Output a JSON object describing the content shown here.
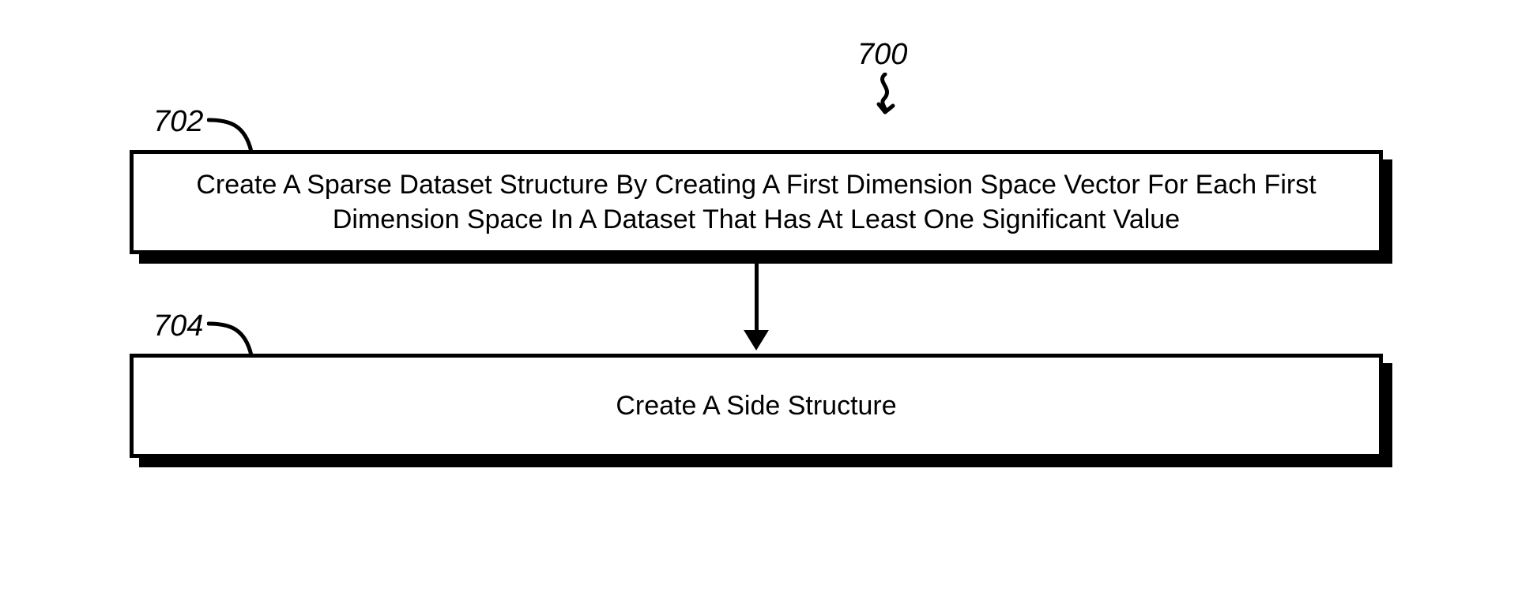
{
  "diagram": {
    "id_label": "700",
    "steps": [
      {
        "ref": "702",
        "text": "Create A Sparse Dataset Structure By Creating A First Dimension Space Vector For Each First Dimension Space In A Dataset That Has At Least One Significant Value"
      },
      {
        "ref": "704",
        "text": "Create A Side Structure"
      }
    ]
  }
}
